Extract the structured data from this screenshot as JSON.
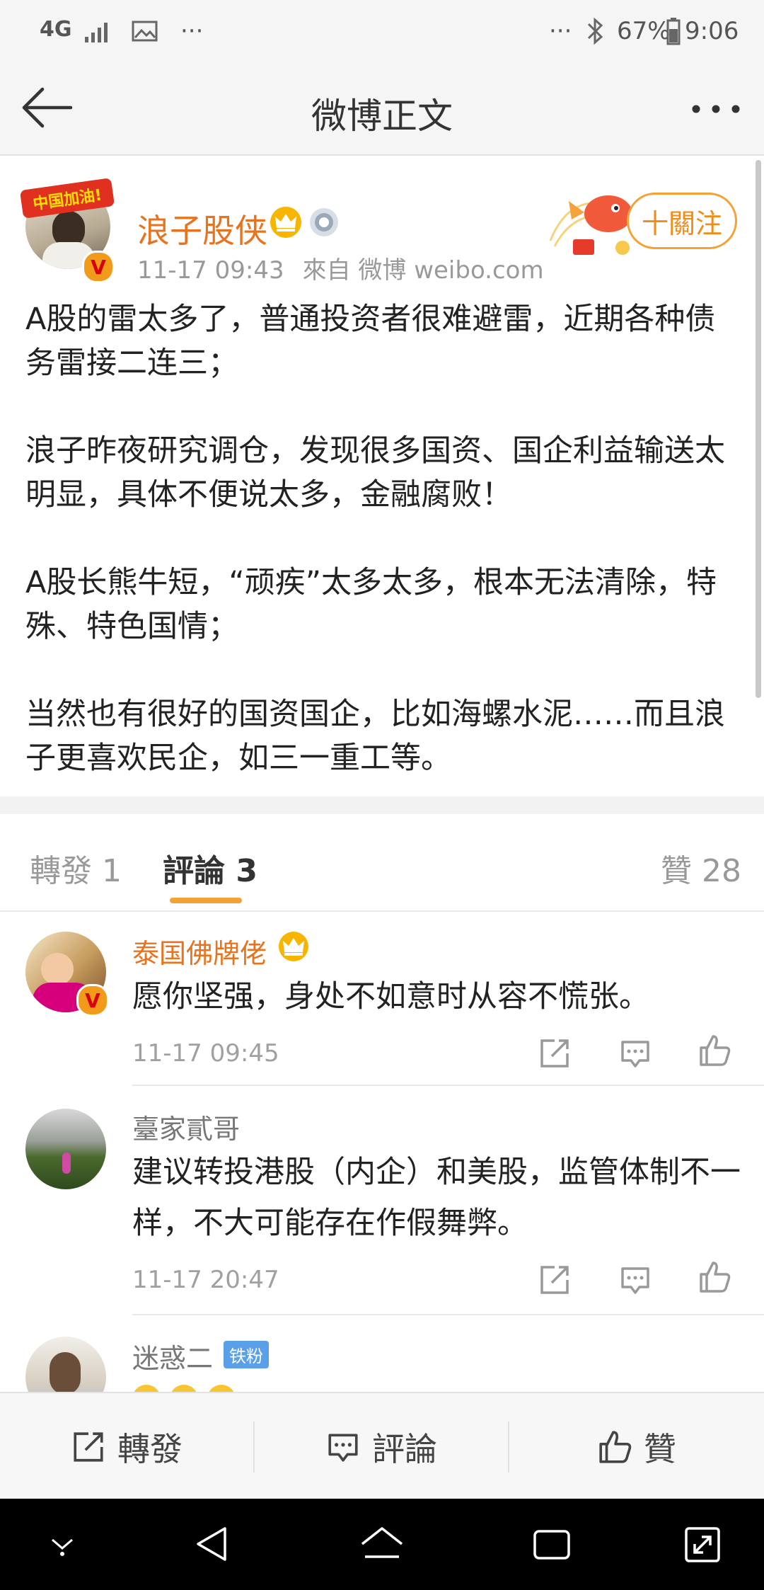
{
  "status_bar": {
    "network": "4G",
    "battery": "67%",
    "time": "9:06",
    "more": "···",
    "more_left": "···"
  },
  "nav": {
    "title": "微博正文",
    "back_icon": "arrow-left-icon",
    "more_icon": "more-dots-icon"
  },
  "post": {
    "username": "浪子股侠",
    "badges": [
      "crown-icon",
      "medal-icon"
    ],
    "verified": "V",
    "avatar_banner": "中国加油!",
    "time": "11-17 09:43",
    "source": "來自 微博 weibo.com",
    "follow_label": "十關注",
    "paragraphs": [
      "A股的雷太多了，普通投资者很难避雷，近期各种债务雷接二连三；",
      "浪子昨夜研究调仓，发现很多国资、国企利益输送太明显，具体不便说太多，金融腐败！",
      "A股长熊牛短，“顽疾”太多太多，根本无法清除，特殊、特色国情；",
      "当然也有很好的国资国企，比如海螺水泥……而且浪子更喜欢民企，如三一重工等。"
    ]
  },
  "tabs": {
    "repost": "轉發 1",
    "comments": "評論 3",
    "likes": "贊 28"
  },
  "comments": [
    {
      "name": "泰国佛牌佬",
      "text": "愿你坚强，身处不如意时从容不慌张。",
      "time": "11-17 09:45",
      "name_color": "#e8731e"
    },
    {
      "name": "臺家貳哥",
      "text": "建议转投港股（内企）和美股，监管体制不一样，不大可能存在作假舞弊。",
      "time": "11-17 20:47",
      "name_color": "#777777"
    },
    {
      "name": "迷惑二",
      "badge": "铁粉",
      "name_color": "#777777"
    }
  ],
  "action_bar": {
    "repost": "轉發",
    "comment": "評論",
    "like": "贊"
  },
  "colors": {
    "accent": "#f08d16",
    "username": "#e8731e",
    "background": "#f5f5f5"
  }
}
